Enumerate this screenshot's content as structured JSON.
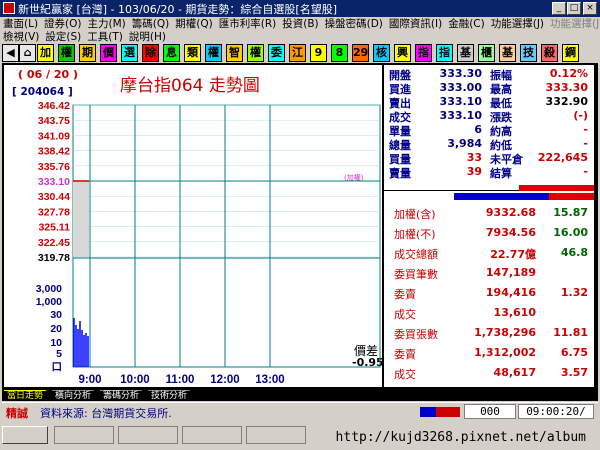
{
  "window": {
    "title": "新世紀贏家 [台灣] - 103/06/20 - 期貨走勢：綜合自選股[名望股]"
  },
  "menu1": [
    "畫面(L)",
    "證券(O)",
    "主力(M)",
    "籌碼(Q)",
    "期權(Q)",
    "匯市利率(R)",
    "投資(B)",
    "操盤密碼(D)",
    "國際資訊(I)",
    "金融(C)",
    "功能選擇(J)",
    "功能選擇(J)"
  ],
  "menu2": [
    "檢視(V)",
    "設定(S)",
    "工具(T)",
    "說明(H)"
  ],
  "toolbar": {
    "items": [
      "加",
      "權",
      "期",
      "價",
      "選",
      "除",
      "息",
      "類",
      "權",
      "智",
      "權",
      "委",
      "江",
      "9",
      "8",
      "29",
      "核",
      "興",
      "指",
      "指",
      "基",
      "櫃",
      "基",
      "技",
      "殺",
      "鋼"
    ]
  },
  "chart": {
    "date_tag": "( 06 / 20 )",
    "code_tag": "[ 204064 ]",
    "title": "摩台指064 走勢圖",
    "ref_tag": "(加權)",
    "diff_label": "價差",
    "diff_value": "-0.95",
    "volume_ticks": [
      "3,000",
      "1,000",
      "30",
      "20",
      "10",
      "5",
      "口"
    ]
  },
  "chart_data": {
    "type": "line",
    "title": "摩台指064 走勢圖",
    "price_ticks": [
      "346.42",
      "343.75",
      "341.09",
      "338.42",
      "335.76",
      "333.10",
      "330.44",
      "327.78",
      "325.11",
      "322.45",
      "319.78"
    ],
    "ylim": [
      319.78,
      346.42
    ],
    "x_ticks": [
      "9:00",
      "10:00",
      "11:00",
      "12:00",
      "13:00"
    ],
    "series": [
      {
        "values": [
          333.1,
          333.1
        ]
      }
    ]
  },
  "info": {
    "rows": [
      {
        "l1": "開盤",
        "v1": "333.30",
        "l2": "振幅",
        "v2": "0.12%"
      },
      {
        "l1": "買進",
        "v1": "333.00",
        "l2": "最高",
        "v2": "333.30"
      },
      {
        "l1": "賣出",
        "v1": "333.10",
        "l2": "最低",
        "v2": "332.90"
      },
      {
        "l1": "成交",
        "v1": "333.10",
        "l2": "漲跌",
        "v2": "(-)"
      },
      {
        "l1": "單量",
        "v1": "6",
        "l2": "約高",
        "v2": "-"
      },
      {
        "l1": "總量",
        "v1": "3,984",
        "l2": "約低",
        "v2": "-"
      },
      {
        "l1": "買量",
        "v1": "33",
        "l2": "未平倉",
        "v2": "222,645"
      },
      {
        "l1": "賣量",
        "v1": "39",
        "l2": "結算",
        "v2": "-"
      }
    ],
    "index_rows": [
      {
        "label": "加權(含)",
        "v1": "9332.68",
        "v2": "15.87"
      },
      {
        "label": "加權(不)",
        "v1": "7934.56",
        "v2": "16.00"
      },
      {
        "label": "成交總額",
        "v1": "22.77億",
        "v2": "46.8"
      }
    ],
    "order_rows": [
      {
        "label": "委買筆數",
        "v1": "147,189",
        "v2": ""
      },
      {
        "label": "委賣",
        "v1": "194,416",
        "v2": "1.32"
      },
      {
        "label": "成交",
        "v1": "13,610",
        "v2": ""
      },
      {
        "label": "委買張數",
        "v1": "1,738,296",
        "v2": "11.81"
      },
      {
        "label": "委賣",
        "v1": "1,312,002",
        "v2": "6.75"
      },
      {
        "label": "成交",
        "v1": "48,617",
        "v2": "3.57"
      }
    ]
  },
  "tabs": [
    "當日走勢",
    "橫向分析",
    "籌碼分析",
    "技術分析"
  ],
  "status": {
    "tag": "精誠",
    "source": "資料來源: 台灣期貨交易所.",
    "counter": "000",
    "time": "09:00:20/"
  },
  "watermark": "http://kujd3268.pixnet.net/album",
  "colors": {
    "title_bg": "#0a246a",
    "price_red": "#cc0000",
    "label_blue": "#00008b",
    "grid": "#008080"
  }
}
